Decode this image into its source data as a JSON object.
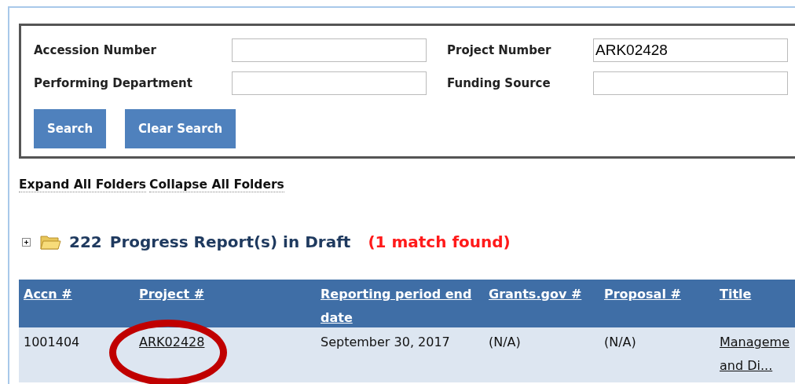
{
  "search_form": {
    "fields": [
      {
        "label": "Accession Number"
      },
      {
        "label": "Project Number",
        "value": "ARK02428"
      },
      {
        "label": "Performing Department"
      },
      {
        "label": "Funding Source"
      }
    ],
    "buttons": [
      "Search",
      "Clear Search"
    ]
  },
  "folder_links": [
    "Expand All Folders",
    "Collapse All Folders"
  ],
  "folder": {
    "expanded": false,
    "count": "222",
    "label": "Progress Report(s) in Draft",
    "match_text": "(1 match found)"
  },
  "table": {
    "columns": [
      "Accn #",
      "Project #",
      "Reporting period end date",
      "Grants.gov #",
      "Proposal #",
      "Title"
    ],
    "rows": [
      {
        "cells": [
          "1001404",
          "ARK02428",
          "September 30, 2017",
          "(N/A)",
          "(N/A)",
          "Manageme and Di..."
        ],
        "links": [
          false,
          true,
          false,
          false,
          false,
          true
        ],
        "circled": [
          false,
          true,
          false,
          false,
          false,
          false
        ]
      }
    ]
  }
}
